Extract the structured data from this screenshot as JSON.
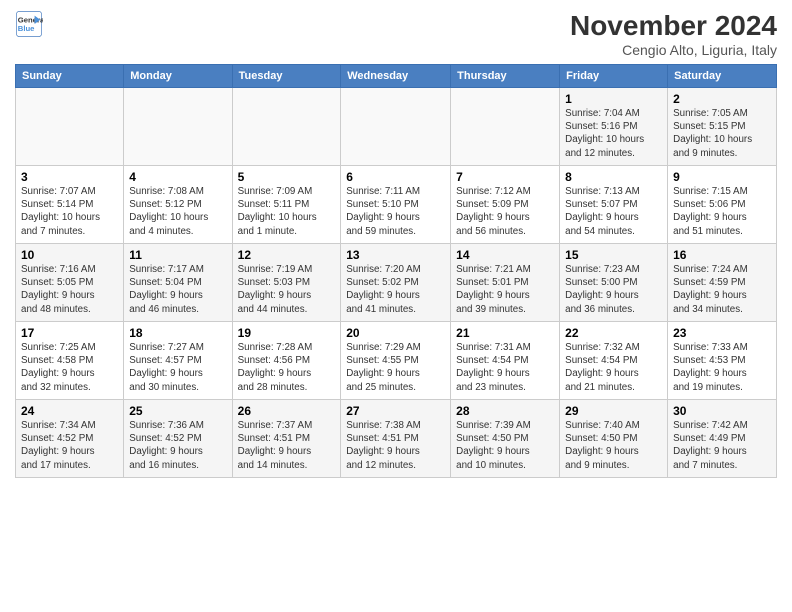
{
  "header": {
    "logo_line1": "General",
    "logo_line2": "Blue",
    "month": "November 2024",
    "location": "Cengio Alto, Liguria, Italy"
  },
  "weekdays": [
    "Sunday",
    "Monday",
    "Tuesday",
    "Wednesday",
    "Thursday",
    "Friday",
    "Saturday"
  ],
  "weeks": [
    [
      {
        "day": "",
        "info": ""
      },
      {
        "day": "",
        "info": ""
      },
      {
        "day": "",
        "info": ""
      },
      {
        "day": "",
        "info": ""
      },
      {
        "day": "",
        "info": ""
      },
      {
        "day": "1",
        "info": "Sunrise: 7:04 AM\nSunset: 5:16 PM\nDaylight: 10 hours\nand 12 minutes."
      },
      {
        "day": "2",
        "info": "Sunrise: 7:05 AM\nSunset: 5:15 PM\nDaylight: 10 hours\nand 9 minutes."
      }
    ],
    [
      {
        "day": "3",
        "info": "Sunrise: 7:07 AM\nSunset: 5:14 PM\nDaylight: 10 hours\nand 7 minutes."
      },
      {
        "day": "4",
        "info": "Sunrise: 7:08 AM\nSunset: 5:12 PM\nDaylight: 10 hours\nand 4 minutes."
      },
      {
        "day": "5",
        "info": "Sunrise: 7:09 AM\nSunset: 5:11 PM\nDaylight: 10 hours\nand 1 minute."
      },
      {
        "day": "6",
        "info": "Sunrise: 7:11 AM\nSunset: 5:10 PM\nDaylight: 9 hours\nand 59 minutes."
      },
      {
        "day": "7",
        "info": "Sunrise: 7:12 AM\nSunset: 5:09 PM\nDaylight: 9 hours\nand 56 minutes."
      },
      {
        "day": "8",
        "info": "Sunrise: 7:13 AM\nSunset: 5:07 PM\nDaylight: 9 hours\nand 54 minutes."
      },
      {
        "day": "9",
        "info": "Sunrise: 7:15 AM\nSunset: 5:06 PM\nDaylight: 9 hours\nand 51 minutes."
      }
    ],
    [
      {
        "day": "10",
        "info": "Sunrise: 7:16 AM\nSunset: 5:05 PM\nDaylight: 9 hours\nand 48 minutes."
      },
      {
        "day": "11",
        "info": "Sunrise: 7:17 AM\nSunset: 5:04 PM\nDaylight: 9 hours\nand 46 minutes."
      },
      {
        "day": "12",
        "info": "Sunrise: 7:19 AM\nSunset: 5:03 PM\nDaylight: 9 hours\nand 44 minutes."
      },
      {
        "day": "13",
        "info": "Sunrise: 7:20 AM\nSunset: 5:02 PM\nDaylight: 9 hours\nand 41 minutes."
      },
      {
        "day": "14",
        "info": "Sunrise: 7:21 AM\nSunset: 5:01 PM\nDaylight: 9 hours\nand 39 minutes."
      },
      {
        "day": "15",
        "info": "Sunrise: 7:23 AM\nSunset: 5:00 PM\nDaylight: 9 hours\nand 36 minutes."
      },
      {
        "day": "16",
        "info": "Sunrise: 7:24 AM\nSunset: 4:59 PM\nDaylight: 9 hours\nand 34 minutes."
      }
    ],
    [
      {
        "day": "17",
        "info": "Sunrise: 7:25 AM\nSunset: 4:58 PM\nDaylight: 9 hours\nand 32 minutes."
      },
      {
        "day": "18",
        "info": "Sunrise: 7:27 AM\nSunset: 4:57 PM\nDaylight: 9 hours\nand 30 minutes."
      },
      {
        "day": "19",
        "info": "Sunrise: 7:28 AM\nSunset: 4:56 PM\nDaylight: 9 hours\nand 28 minutes."
      },
      {
        "day": "20",
        "info": "Sunrise: 7:29 AM\nSunset: 4:55 PM\nDaylight: 9 hours\nand 25 minutes."
      },
      {
        "day": "21",
        "info": "Sunrise: 7:31 AM\nSunset: 4:54 PM\nDaylight: 9 hours\nand 23 minutes."
      },
      {
        "day": "22",
        "info": "Sunrise: 7:32 AM\nSunset: 4:54 PM\nDaylight: 9 hours\nand 21 minutes."
      },
      {
        "day": "23",
        "info": "Sunrise: 7:33 AM\nSunset: 4:53 PM\nDaylight: 9 hours\nand 19 minutes."
      }
    ],
    [
      {
        "day": "24",
        "info": "Sunrise: 7:34 AM\nSunset: 4:52 PM\nDaylight: 9 hours\nand 17 minutes."
      },
      {
        "day": "25",
        "info": "Sunrise: 7:36 AM\nSunset: 4:52 PM\nDaylight: 9 hours\nand 16 minutes."
      },
      {
        "day": "26",
        "info": "Sunrise: 7:37 AM\nSunset: 4:51 PM\nDaylight: 9 hours\nand 14 minutes."
      },
      {
        "day": "27",
        "info": "Sunrise: 7:38 AM\nSunset: 4:51 PM\nDaylight: 9 hours\nand 12 minutes."
      },
      {
        "day": "28",
        "info": "Sunrise: 7:39 AM\nSunset: 4:50 PM\nDaylight: 9 hours\nand 10 minutes."
      },
      {
        "day": "29",
        "info": "Sunrise: 7:40 AM\nSunset: 4:50 PM\nDaylight: 9 hours\nand 9 minutes."
      },
      {
        "day": "30",
        "info": "Sunrise: 7:42 AM\nSunset: 4:49 PM\nDaylight: 9 hours\nand 7 minutes."
      }
    ]
  ]
}
